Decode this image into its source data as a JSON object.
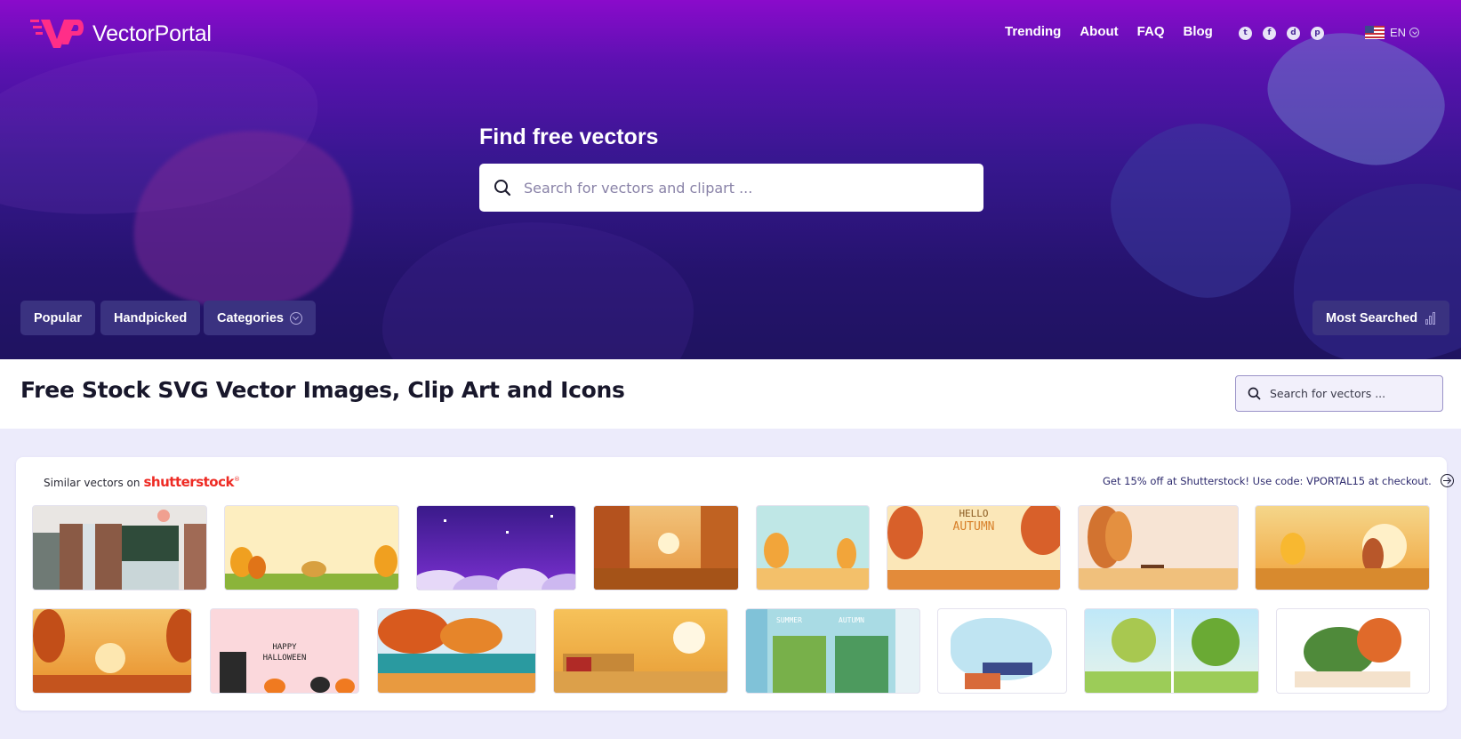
{
  "brand": {
    "name": "VectorPortal",
    "logo": "VP"
  },
  "nav": {
    "links": [
      "Trending",
      "About",
      "FAQ",
      "Blog"
    ]
  },
  "socials": [
    {
      "icon": "twitter-icon",
      "glyph": "t"
    },
    {
      "icon": "facebook-icon",
      "glyph": "f"
    },
    {
      "icon": "dribbble-icon",
      "glyph": "d"
    },
    {
      "icon": "pinterest-icon",
      "glyph": "p"
    }
  ],
  "language": {
    "code": "EN",
    "flag": "us-flag-icon"
  },
  "hero": {
    "title": "Find free vectors",
    "search_placeholder": "Search for vectors and clipart ..."
  },
  "filters": {
    "popular": "Popular",
    "handpicked": "Handpicked",
    "categories": "Categories",
    "most_searched": "Most Searched"
  },
  "page": {
    "title": "Free Stock SVG Vector Images, Clip Art and Icons",
    "search_placeholder": "Search for vectors ..."
  },
  "shutterstock": {
    "label": "Similar vectors on",
    "logo_text": "shutterstock",
    "promo": "Get 15% off at Shutterstock! Use code: VPORTAL15 at checkout."
  },
  "thumb_text": {
    "hello_autumn_1": "HELLO",
    "hello_autumn_2": "AUTUMN",
    "halloween_1": "HAPPY",
    "halloween_2": "HALLOWEEN",
    "summer": "SUMMER",
    "autumn": "AUTUMN"
  },
  "colors": {
    "accent": "#ff2e88",
    "hero_top": "#8a0bcb",
    "hero_bottom": "#1f1360",
    "pill": "#3a3280",
    "shutterstock_red": "#ee2b24"
  }
}
